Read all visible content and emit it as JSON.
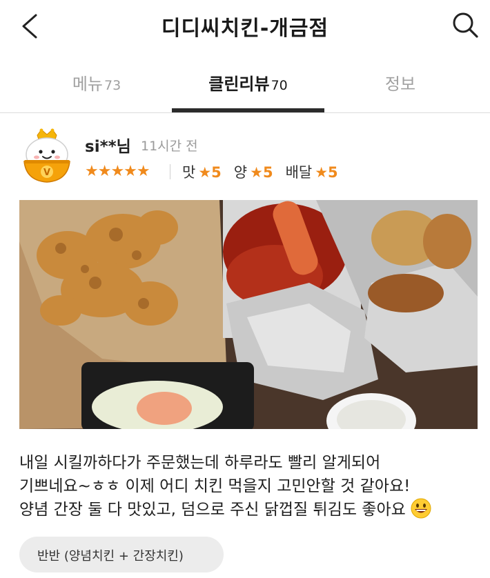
{
  "header": {
    "title": "디디씨치킨-개금점"
  },
  "tabs": [
    {
      "label": "메뉴",
      "count": "73"
    },
    {
      "label": "클린리뷰",
      "count": "70"
    },
    {
      "label": "정보",
      "count": ""
    }
  ],
  "review": {
    "author": "si**님",
    "time": "11시간 전",
    "stars": "★★★★★",
    "ratings": [
      {
        "label": "맛",
        "star": "★",
        "score": "5"
      },
      {
        "label": "양",
        "star": "★",
        "score": "5"
      },
      {
        "label": "배달",
        "star": "★",
        "score": "5"
      }
    ],
    "text_lines": [
      "내일 시킬까하다가 주문했는데 하루라도 빨리 알게되어",
      "기쁘네요~ㅎㅎ 이제 어디 치킨 먹을지 고민안할 것 같아요!",
      "양념 간장 둘 다 맛있고, 덤으로 주신 닭껍질 튀김도 좋아요"
    ],
    "menu_tag": "반반 (양념치킨 + 간장치킨)"
  },
  "colors": {
    "accent_orange": "#f08a1c",
    "tab_indicator": "#2b2b2b",
    "muted_text": "#a0a0a0"
  }
}
